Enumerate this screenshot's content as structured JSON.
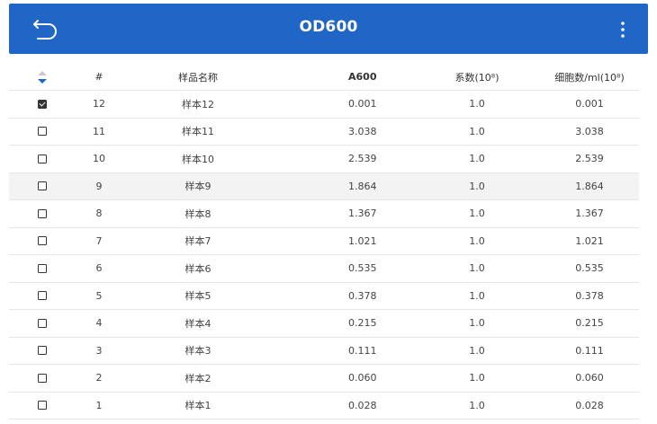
{
  "app_bar": {
    "title": "OD600",
    "back_icon": "back-arrow-icon",
    "menu_icon": "more-vert-icon",
    "color": "#1f66c7"
  },
  "table": {
    "sort_icon": "sort-icon",
    "columns": [
      "#",
      "样品名称",
      "A600",
      "系数(10⁸)",
      "细胞数/ml(10⁸)"
    ],
    "rows": [
      {
        "checked": true,
        "num": "12",
        "name": "样本12",
        "a600": "0.001",
        "coef": "1.0",
        "cells": "0.001"
      },
      {
        "checked": false,
        "num": "11",
        "name": "样本11",
        "a600": "3.038",
        "coef": "1.0",
        "cells": "3.038"
      },
      {
        "checked": false,
        "num": "10",
        "name": "样本10",
        "a600": "2.539",
        "coef": "1.0",
        "cells": "2.539"
      },
      {
        "checked": false,
        "num": "9",
        "name": "样本9",
        "a600": "1.864",
        "coef": "1.0",
        "cells": "1.864"
      },
      {
        "checked": false,
        "num": "8",
        "name": "样本8",
        "a600": "1.367",
        "coef": "1.0",
        "cells": "1.367"
      },
      {
        "checked": false,
        "num": "7",
        "name": "样本7",
        "a600": "1.021",
        "coef": "1.0",
        "cells": "1.021"
      },
      {
        "checked": false,
        "num": "6",
        "name": "样本6",
        "a600": "0.535",
        "coef": "1.0",
        "cells": "0.535"
      },
      {
        "checked": false,
        "num": "5",
        "name": "样本5",
        "a600": "0.378",
        "coef": "1.0",
        "cells": "0.378"
      },
      {
        "checked": false,
        "num": "4",
        "name": "样本4",
        "a600": "0.215",
        "coef": "1.0",
        "cells": "0.215"
      },
      {
        "checked": false,
        "num": "3",
        "name": "样本3",
        "a600": "0.111",
        "coef": "1.0",
        "cells": "0.111"
      },
      {
        "checked": false,
        "num": "2",
        "name": "样本2",
        "a600": "0.060",
        "coef": "1.0",
        "cells": "0.060"
      },
      {
        "checked": false,
        "num": "1",
        "name": "样本1",
        "a600": "0.028",
        "coef": "1.0",
        "cells": "0.028"
      }
    ]
  }
}
